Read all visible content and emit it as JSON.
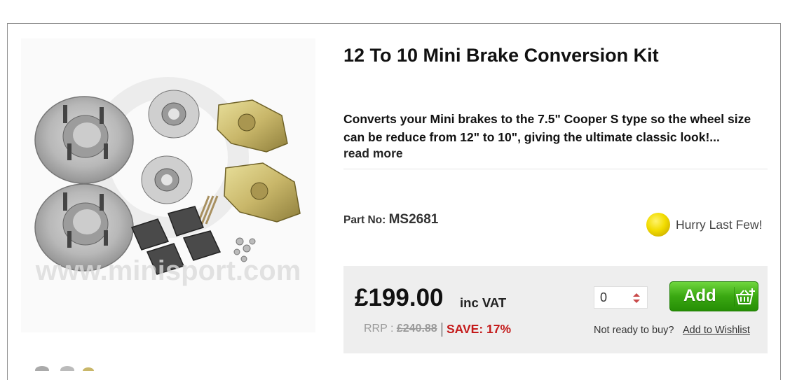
{
  "product": {
    "title": "12 To 10 Mini Brake Conversion Kit",
    "description": "Converts your Mini brakes to the 7.5\" Cooper S type so the wheel size can be reduce from 12\" to 10\", giving the ultimate classic look!...",
    "read_more": "read more",
    "part_no_label": "Part No:",
    "part_no": "MS2681",
    "stock_status": "Hurry Last Few!",
    "image_watermark": "www.minisport.com"
  },
  "buy": {
    "price": "£199.00",
    "vat_label": "inc VAT",
    "rrp_label": "RRP :",
    "rrp_value": "£240.88",
    "save_label": "SAVE: 17%",
    "quantity": "0",
    "add_label": "Add",
    "not_ready": "Not ready to buy?",
    "wishlist": "Add to Wishlist"
  },
  "icons": {
    "stock": "yellow-dot-icon",
    "quantity": "spinner-arrows-icon",
    "add": "basket-plus-icon"
  },
  "colors": {
    "save": "#c41a1a",
    "add_button": "#3aa812",
    "stock_dot": "#f2dc00",
    "buybox_bg": "#eeeeee"
  }
}
